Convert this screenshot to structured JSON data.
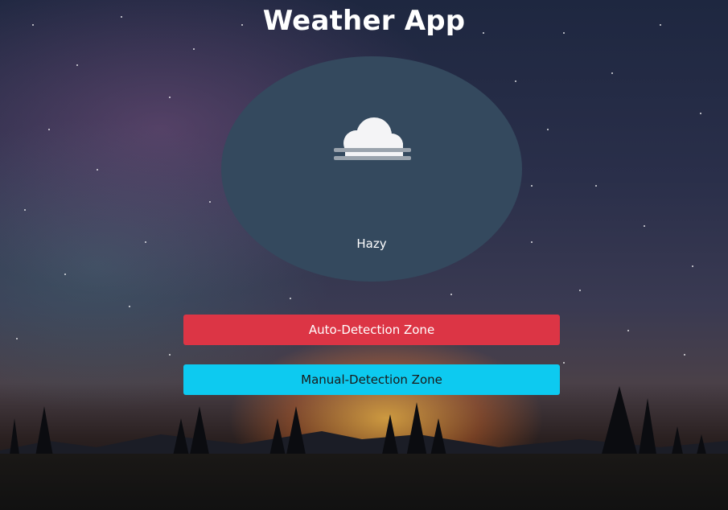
{
  "header": {
    "title": "Weather App"
  },
  "weather": {
    "icon": "cloud-icon",
    "condition": "Hazy"
  },
  "actions": {
    "auto_label": "Auto-Detection Zone",
    "manual_label": "Manual-Detection Zone"
  },
  "colors": {
    "oval": "#34495e",
    "auto_button": "#dc3545",
    "manual_button": "#0dcaf0"
  }
}
